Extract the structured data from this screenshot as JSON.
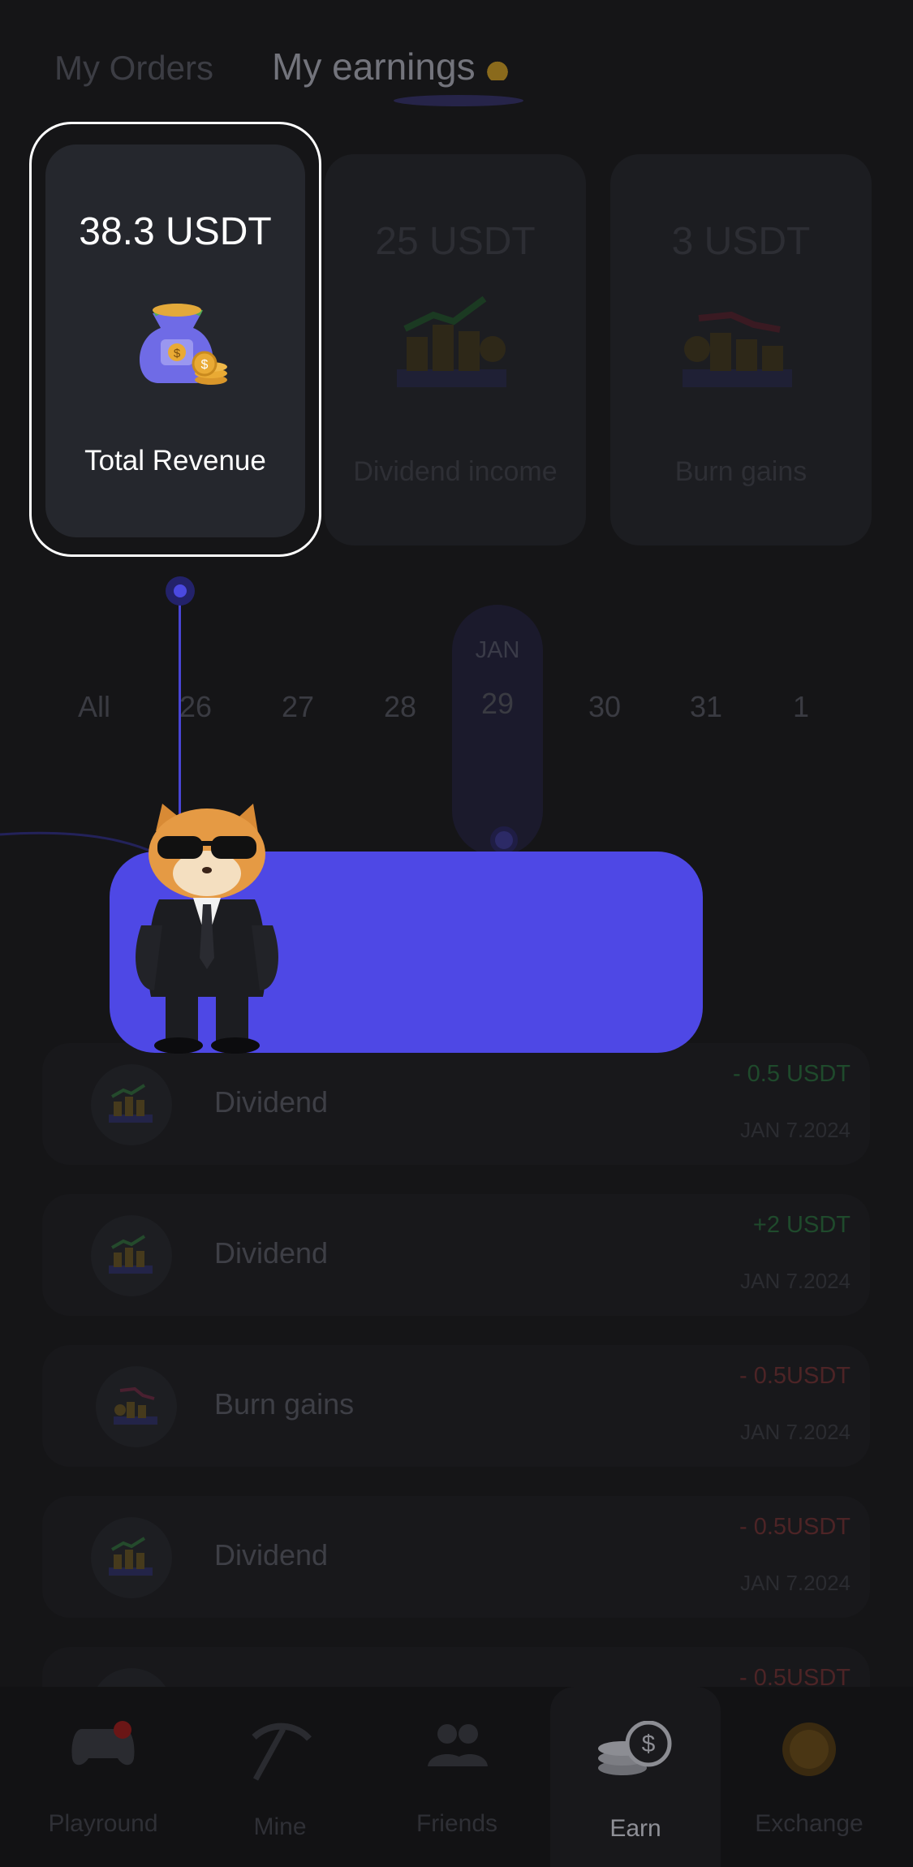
{
  "tabs": [
    {
      "label": "My Orders",
      "active": false
    },
    {
      "label": "My earnings",
      "active": true
    }
  ],
  "stats": {
    "total": {
      "value": "38.3 USDT",
      "label": "Total Revenue"
    },
    "dividend": {
      "value": "25 USDT",
      "label": "Dividend income"
    },
    "burn": {
      "value": "3 USDT",
      "label": "Burn gains"
    }
  },
  "dates": {
    "month": "JAN",
    "items": [
      "All",
      "26",
      "27",
      "28",
      "29",
      "30",
      "31",
      "1"
    ],
    "selected": "29"
  },
  "transactions": [
    {
      "name": "Dividend",
      "amount": "- 0.5 USDT",
      "date": "JAN 7.2024",
      "type": "dividend",
      "sign": "pos"
    },
    {
      "name": "Dividend",
      "amount": "+2 USDT",
      "date": "JAN 7.2024",
      "type": "dividend",
      "sign": "pos"
    },
    {
      "name": "Burn gains",
      "amount": "- 0.5USDT",
      "date": "JAN 7.2024",
      "type": "burn",
      "sign": "neg"
    },
    {
      "name": "Dividend",
      "amount": "- 0.5USDT",
      "date": "JAN 7.2024",
      "type": "dividend",
      "sign": "neg"
    },
    {
      "name": "",
      "amount": "- 0.5USDT",
      "date": "",
      "type": "dividend",
      "sign": "neg"
    }
  ],
  "nav": [
    {
      "label": "Playround",
      "icon": "gamepad-icon",
      "badge": true
    },
    {
      "label": "Mine",
      "icon": "pickaxe-icon",
      "badge": false
    },
    {
      "label": "Friends",
      "icon": "friends-icon",
      "badge": false
    },
    {
      "label": "Earn",
      "icon": "coins-icon",
      "badge": false,
      "active": true
    },
    {
      "label": "Exchange",
      "icon": "exchange-token-icon",
      "badge": false
    }
  ],
  "colors": {
    "accent": "#4e48e5",
    "background": "#151517",
    "positive": "#2e7a44",
    "negative": "#8a3236"
  }
}
